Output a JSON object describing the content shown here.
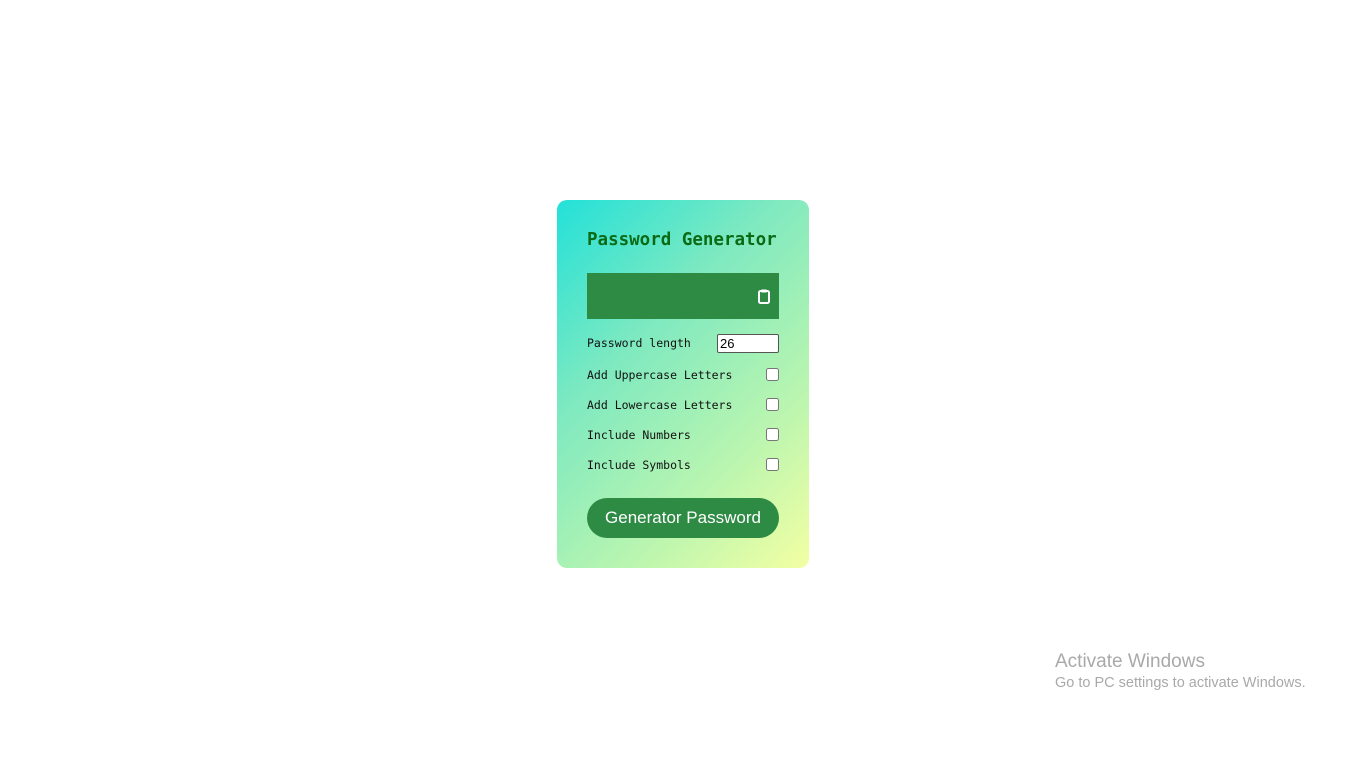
{
  "card": {
    "title": "Password Generator",
    "result_text": "",
    "clipboard_icon": "clipboard-icon",
    "length_label": "Password length",
    "length_value": "26",
    "options": [
      {
        "label": "Add Uppercase Letters",
        "checked": false
      },
      {
        "label": "Add Lowercase Letters",
        "checked": false
      },
      {
        "label": "Include Numbers",
        "checked": false
      },
      {
        "label": "Include Symbols",
        "checked": false
      }
    ],
    "generate_label": "Generator Password"
  },
  "watermark": {
    "title": "Activate Windows",
    "subtitle": "Go to PC settings to activate Windows."
  },
  "colors": {
    "title": "#0a6b14",
    "accent_green": "#2e8b43",
    "gradient_start": "#22e1d9",
    "gradient_end": "#f3ffa3"
  }
}
